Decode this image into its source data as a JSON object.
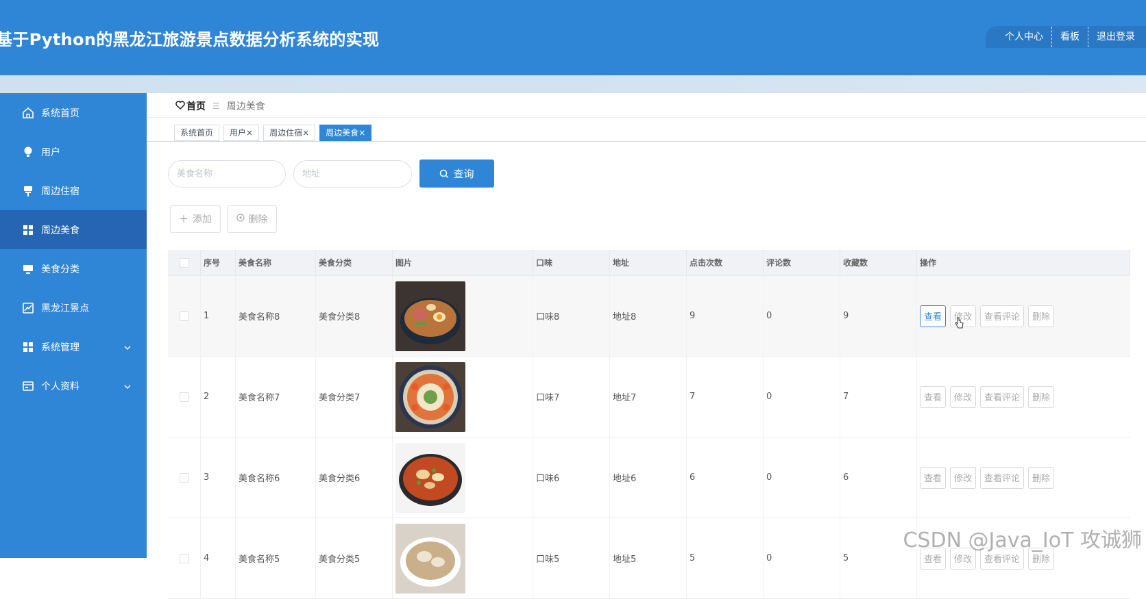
{
  "app": {
    "title": "基于Python的黑龙江旅游景点数据分析系统的实现"
  },
  "top_nav": {
    "items": [
      "个人中心",
      "看板",
      "退出登录"
    ]
  },
  "sidebar": {
    "items": [
      {
        "label": "系统首页",
        "icon": "home-icon"
      },
      {
        "label": "用户",
        "icon": "user-icon"
      },
      {
        "label": "周边住宿",
        "icon": "lodging-icon"
      },
      {
        "label": "周边美食",
        "icon": "grid-icon",
        "active": true
      },
      {
        "label": "美食分类",
        "icon": "monitor-icon"
      },
      {
        "label": "黑龙江景点",
        "icon": "chart-icon"
      },
      {
        "label": "系统管理",
        "icon": "grid-icon",
        "expandable": true
      },
      {
        "label": "个人资料",
        "icon": "card-icon",
        "expandable": true
      }
    ]
  },
  "breadcrumb": {
    "home": "首页",
    "current": "周边美食"
  },
  "tabs": [
    {
      "label": "系统首页",
      "closable": false
    },
    {
      "label": "用户",
      "closable": true
    },
    {
      "label": "周边住宿",
      "closable": true
    },
    {
      "label": "周边美食",
      "closable": true,
      "active": true
    }
  ],
  "search": {
    "name_placeholder": "美食名称",
    "address_placeholder": "地址",
    "button_label": "查询"
  },
  "actions": {
    "add_label": "添加",
    "delete_label": "删除"
  },
  "table": {
    "columns": [
      "序号",
      "美食名称",
      "美食分类",
      "图片",
      "口味",
      "地址",
      "点击次数",
      "评论数",
      "收藏数",
      "操作"
    ],
    "op_labels": [
      "查看",
      "修改",
      "查看评论",
      "删除"
    ],
    "rows": [
      {
        "index": "1",
        "name": "美食名称8",
        "category": "美食分类8",
        "taste": "口味8",
        "address": "地址8",
        "clicks": "9",
        "comments": "0",
        "favorites": "9"
      },
      {
        "index": "2",
        "name": "美食名称7",
        "category": "美食分类7",
        "taste": "口味7",
        "address": "地址7",
        "clicks": "7",
        "comments": "0",
        "favorites": "7"
      },
      {
        "index": "3",
        "name": "美食名称6",
        "category": "美食分类6",
        "taste": "口味6",
        "address": "地址6",
        "clicks": "6",
        "comments": "0",
        "favorites": "6"
      },
      {
        "index": "4",
        "name": "美食名称5",
        "category": "美食分类5",
        "taste": "口味5",
        "address": "地址5",
        "clicks": "5",
        "comments": "0",
        "favorites": "5"
      }
    ]
  },
  "watermark": "CSDN @Java_IoT 攻诚狮",
  "colors": {
    "primary": "#2f86d6",
    "sidebar_active": "#2565b3"
  }
}
